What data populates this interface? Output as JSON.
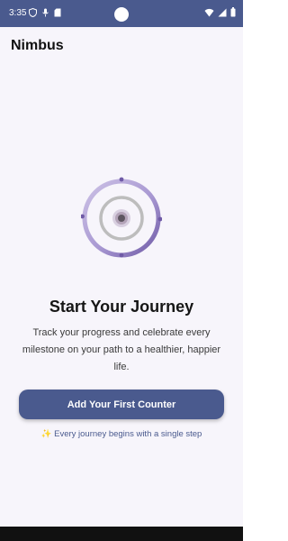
{
  "status_bar": {
    "time": "3:35",
    "left_icons": [
      "vpn-shield-icon",
      "mic-icon",
      "sim-card-icon"
    ],
    "right_icons": [
      "wifi-icon",
      "cellular-signal-icon",
      "battery-icon"
    ]
  },
  "app": {
    "title": "Nimbus"
  },
  "empty_state": {
    "illustration": "concentric-rings-illustration",
    "headline": "Start Your Journey",
    "description": "Track your progress and celebrate every milestone on your path to a healthier, happier life.",
    "cta_label": "Add Your First Counter",
    "tagline": "✨ Every journey begins with a single step"
  },
  "colors": {
    "accent": "#4a5a8e",
    "ring_outer": "#b8a9d9",
    "ring_outer_dark": "#6f5aa6",
    "ring_inner": "#b6b6b6",
    "background": "#f7f5fb"
  }
}
